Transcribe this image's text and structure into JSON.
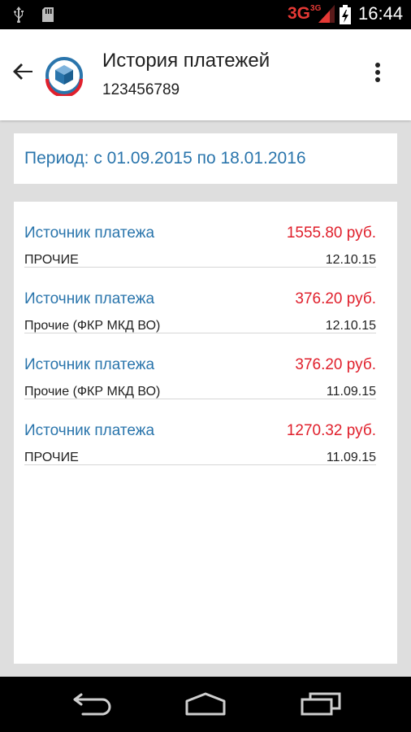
{
  "status_bar": {
    "network": "3G",
    "network_sup": "3G",
    "time": "16:44",
    "icons": [
      "usb-icon",
      "sd-card-icon",
      "signal-icon",
      "battery-charging-icon"
    ],
    "network_color": "#e53935"
  },
  "app_bar": {
    "title": "История платежей",
    "subtitle": "123456789",
    "icons": [
      "back-arrow-icon",
      "app-logo-icon",
      "overflow-menu-icon"
    ]
  },
  "period": {
    "label": "Период: с 01.09.2015 по 18.01.2016"
  },
  "payments": [
    {
      "source": "Источник платежа",
      "amount": "1555.80 руб.",
      "category": "ПРОЧИЕ",
      "date": "12.10.15"
    },
    {
      "source": "Источник платежа",
      "amount": "376.20 руб.",
      "category": "Прочие (ФКР МКД ВО)",
      "date": "12.10.15"
    },
    {
      "source": "Источник платежа",
      "amount": "376.20 руб.",
      "category": "Прочие (ФКР МКД ВО)",
      "date": "11.09.15"
    },
    {
      "source": "Источник платежа",
      "amount": "1270.32 руб.",
      "category": "ПРОЧИЕ",
      "date": "11.09.15"
    }
  ],
  "nav_bar": {
    "icons": [
      "nav-back-icon",
      "nav-home-icon",
      "nav-recents-icon"
    ]
  },
  "colors": {
    "accent_blue": "#2a75ac",
    "amount_red": "#e0202c",
    "background": "#dedede"
  }
}
